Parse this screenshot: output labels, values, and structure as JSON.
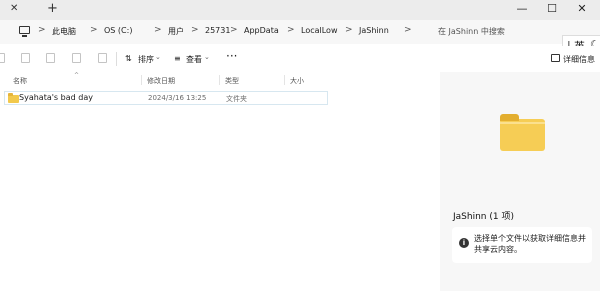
{
  "window": {
    "tab_close": "✕",
    "tab_new": "+",
    "controls": {
      "minimize": "—",
      "maximize": "☐",
      "close": "✕"
    }
  },
  "breadcrumb": {
    "items": [
      "此电脑",
      "OS (C:)",
      "用户",
      "25731",
      "AppData",
      "LocalLow",
      "JaShinn"
    ],
    "separator": ">"
  },
  "search": {
    "placeholder": "在 JaShinn 中搜索"
  },
  "ime": {
    "bar": "|",
    "lang": "英",
    "mode_icon": "moon-icon"
  },
  "toolbar": {
    "sort_label": "排序",
    "view_label": "查看",
    "more_label": "···",
    "details_label": "详细信息",
    "caret": "⌄"
  },
  "columns": {
    "name": "名称",
    "date": "修改日期",
    "type": "类型",
    "size": "大小"
  },
  "files": [
    {
      "name": "Syahata's bad day",
      "date": "2024/3/16 13:25",
      "type": "文件夹",
      "size": ""
    }
  ],
  "details_pane": {
    "title": "JaShinn (1 项)",
    "info": "选择单个文件以获取详细信息并共享云内容。"
  },
  "colors": {
    "folder": "#f6cd55",
    "selection_border": "#d7e7f0",
    "pane_bg": "#f7f7f7"
  }
}
